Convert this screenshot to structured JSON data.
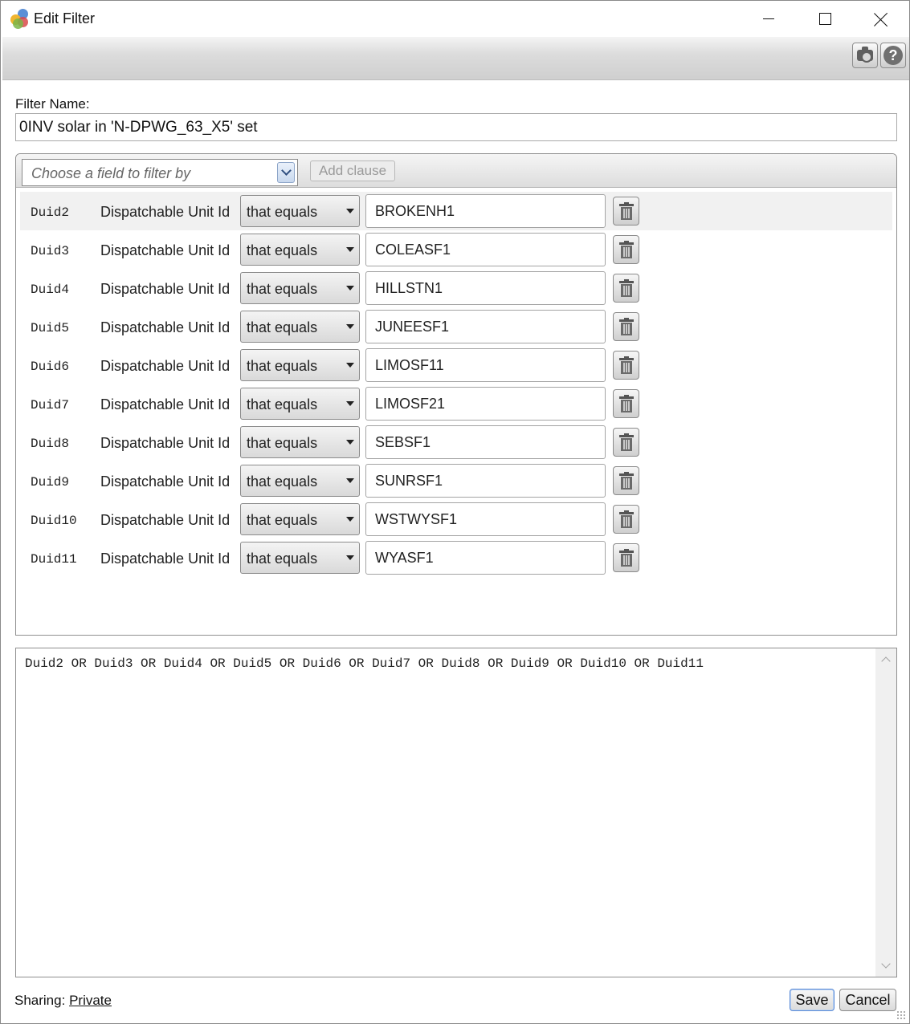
{
  "window": {
    "title": "Edit Filter",
    "app_icon": "app-logo-circles-icon",
    "controls": [
      "minimize-icon",
      "maximize-icon",
      "close-icon"
    ]
  },
  "toolbar": {
    "buttons": [
      {
        "icon": "camera-icon"
      },
      {
        "icon": "help-icon",
        "glyph": "?"
      }
    ]
  },
  "filter_name": {
    "label": "Filter Name:",
    "value": "0INV solar in 'N-DPWG_63_X5' set"
  },
  "clause_panel": {
    "field_select_placeholder": "Choose a field to filter by",
    "add_clause_label": "Add clause",
    "rows": [
      {
        "id": "Duid2",
        "field": "Dispatchable Unit Id",
        "operator": "that equals",
        "value": "BROKENH1"
      },
      {
        "id": "Duid3",
        "field": "Dispatchable Unit Id",
        "operator": "that equals",
        "value": "COLEASF1"
      },
      {
        "id": "Duid4",
        "field": "Dispatchable Unit Id",
        "operator": "that equals",
        "value": "HILLSTN1"
      },
      {
        "id": "Duid5",
        "field": "Dispatchable Unit Id",
        "operator": "that equals",
        "value": "JUNEESF1"
      },
      {
        "id": "Duid6",
        "field": "Dispatchable Unit Id",
        "operator": "that equals",
        "value": "LIMOSF11"
      },
      {
        "id": "Duid7",
        "field": "Dispatchable Unit Id",
        "operator": "that equals",
        "value": "LIMOSF21"
      },
      {
        "id": "Duid8",
        "field": "Dispatchable Unit Id",
        "operator": "that equals",
        "value": "SEBSF1"
      },
      {
        "id": "Duid9",
        "field": "Dispatchable Unit Id",
        "operator": "that equals",
        "value": "SUNRSF1"
      },
      {
        "id": "Duid10",
        "field": "Dispatchable Unit Id",
        "operator": "that equals",
        "value": "WSTWYSF1"
      },
      {
        "id": "Duid11",
        "field": "Dispatchable Unit Id",
        "operator": "that equals",
        "value": "WYASF1"
      }
    ]
  },
  "expression": {
    "text": "Duid2 OR Duid3 OR Duid4 OR Duid5 OR Duid6 OR Duid7 OR Duid8 OR Duid9 OR Duid10 OR Duid11"
  },
  "footer": {
    "sharing_label": "Sharing:",
    "sharing_value": "Private",
    "save_label": "Save",
    "cancel_label": "Cancel"
  }
}
